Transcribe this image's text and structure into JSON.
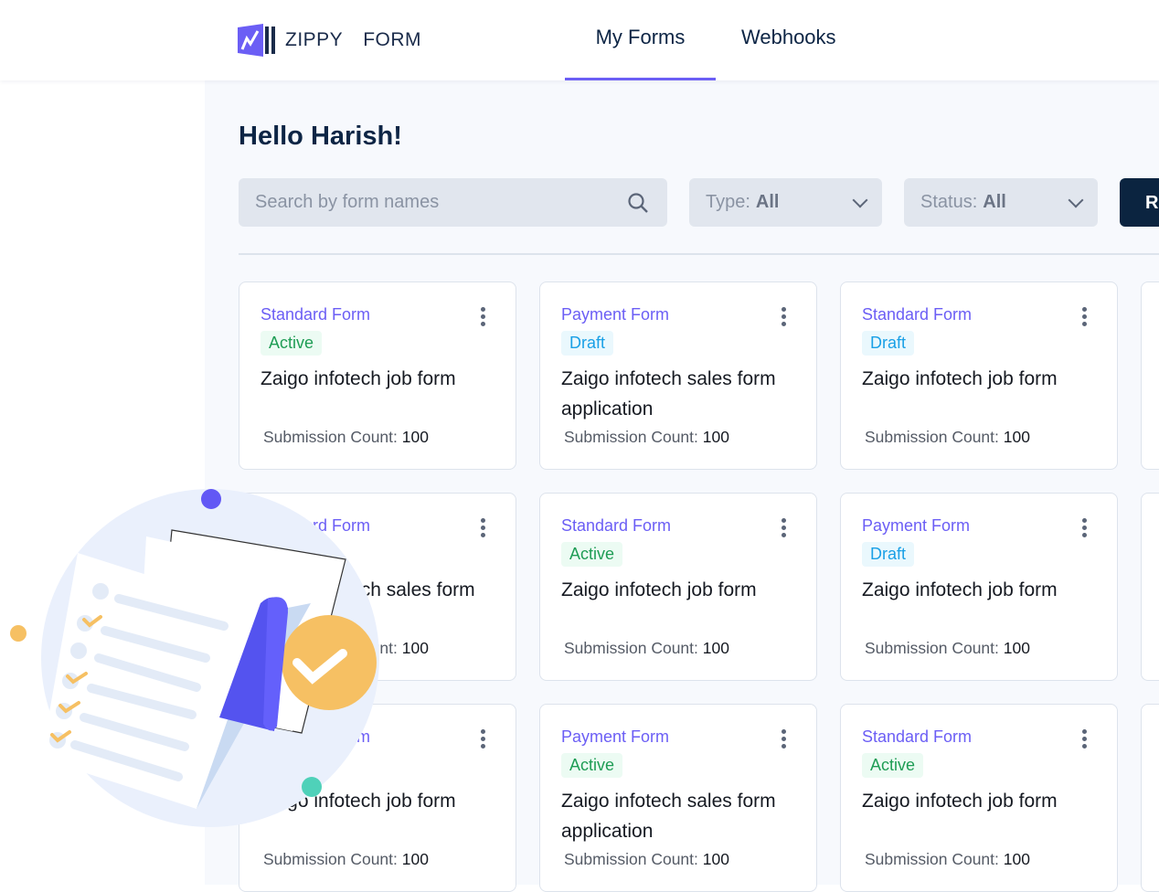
{
  "header": {
    "logo_word1": "ZIPPY",
    "logo_word2": "FORM",
    "tabs": [
      {
        "label": "My Forms",
        "active": true
      },
      {
        "label": "Webhooks",
        "active": false
      }
    ]
  },
  "greeting": "Hello Harish!",
  "filters": {
    "search_placeholder": "Search by form names",
    "type_label": "Type:",
    "type_value": "All",
    "status_label": "Status:",
    "status_value": "All",
    "button_label": "R"
  },
  "colors": {
    "accent": "#6b5ef5",
    "primary_dark": "#0b2440",
    "active": "#1f9d55",
    "draft": "#1aa0e6"
  },
  "count_label": "Submission Count:",
  "cards": [
    {
      "type": "Standard Form",
      "status": "Active",
      "name": "Zaigo infotech job form",
      "count": "100"
    },
    {
      "type": "Payment Form",
      "status": "Draft",
      "name": "Zaigo infotech sales form application",
      "count": "100"
    },
    {
      "type": "Standard Form",
      "status": "Draft",
      "name": "Zaigo infotech job form",
      "count": "100"
    },
    {
      "type": "Standard Form",
      "status": "Active",
      "name": "Zaigo infotech sales form application 2",
      "count": "100"
    },
    {
      "type": "Standard Form",
      "status": "Active",
      "name": "Zaigo infotech job form",
      "count": "100"
    },
    {
      "type": "Payment Form",
      "status": "Draft",
      "name": "Zaigo infotech job form",
      "count": "100"
    },
    {
      "type": "Standard Form",
      "status": "Draft",
      "name": "Zaigo infotech job form",
      "count": "100"
    },
    {
      "type": "Payment Form",
      "status": "Active",
      "name": "Zaigo infotech sales form application",
      "count": "100"
    },
    {
      "type": "Standard Form",
      "status": "Active",
      "name": "Zaigo infotech job form",
      "count": "100"
    }
  ]
}
